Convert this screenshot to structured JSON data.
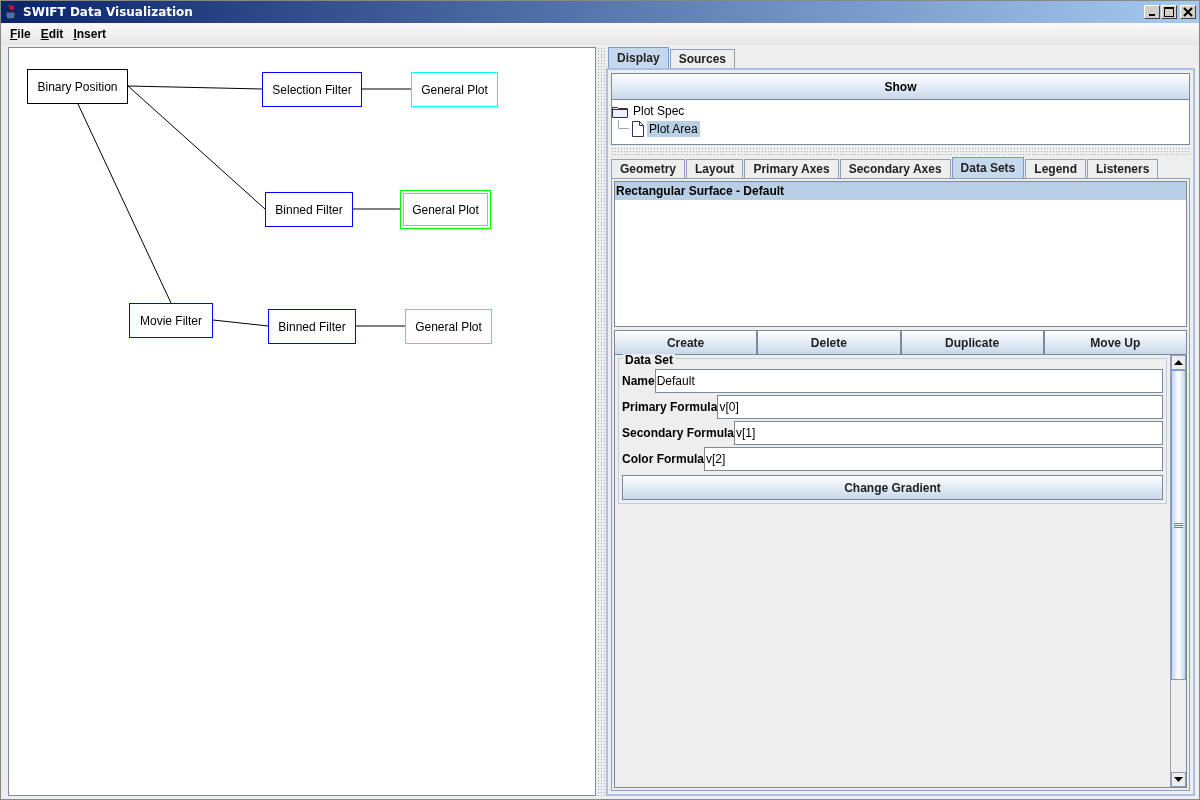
{
  "window": {
    "title": "SWIFT Data Visualization"
  },
  "menu": [
    "File",
    "Edit",
    "Insert"
  ],
  "graph": {
    "nodes": [
      {
        "label": "Binary Position",
        "color": "#000000",
        "selected": false
      },
      {
        "label": "Selection Filter",
        "color": "#0000ff",
        "selected": false
      },
      {
        "label": "General Plot",
        "color": "#00ffff",
        "selected": false
      },
      {
        "label": "Binned Filter",
        "color": "#0000ff",
        "selected": false
      },
      {
        "label": "General Plot",
        "color": "#00ffff",
        "selected": true
      },
      {
        "label": "Movie Filter",
        "color": "#0000ff",
        "selected": false
      },
      {
        "label": "Binned Filter",
        "color": "#0000ff",
        "selected": false
      },
      {
        "label": "General Plot",
        "color": "#00ffff",
        "selected": false
      }
    ]
  },
  "display_tabs": [
    {
      "label": "Display",
      "selected": true
    },
    {
      "label": "Sources",
      "selected": false
    }
  ],
  "show_button": "Show",
  "tree": [
    {
      "label": "Plot Spec",
      "selected": false,
      "children": [
        {
          "label": "Plot Area",
          "selected": true
        }
      ]
    }
  ],
  "property_tabs": [
    {
      "label": "Geometry",
      "selected": false
    },
    {
      "label": "Layout",
      "selected": false
    },
    {
      "label": "Primary Axes",
      "selected": false
    },
    {
      "label": "Secondary Axes",
      "selected": false
    },
    {
      "label": "Data Sets",
      "selected": true
    },
    {
      "label": "Legend",
      "selected": false
    },
    {
      "label": "Listeners",
      "selected": false
    }
  ],
  "data_sets": [
    {
      "label": "Rectangular Surface - Default",
      "selected": true
    }
  ],
  "buttons": [
    "Create",
    "Delete",
    "Duplicate",
    "Move Up"
  ],
  "data_set_group": {
    "title": "Data Set",
    "fields": [
      {
        "label": "Name",
        "value": "Default"
      },
      {
        "label": "Primary Formula",
        "value": "v[0]"
      },
      {
        "label": "Secondary Formula",
        "value": "v[1]"
      },
      {
        "label": "Color Formula",
        "value": "v[2]"
      }
    ],
    "button": "Change Gradient"
  }
}
